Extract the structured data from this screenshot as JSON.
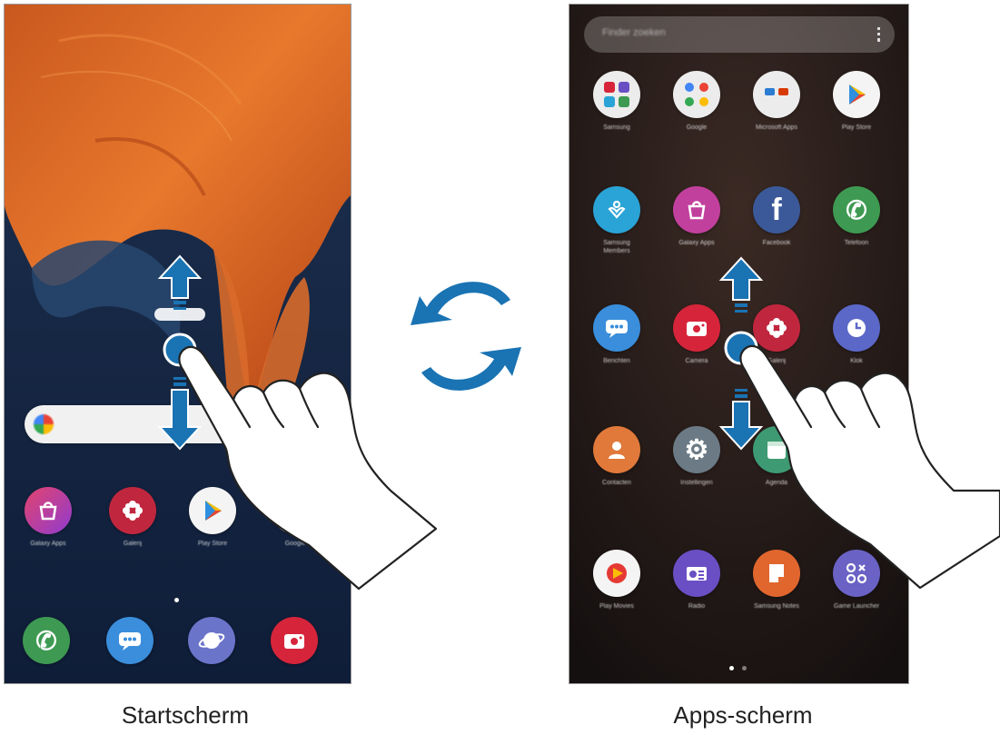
{
  "captions": {
    "home": "Startscherm",
    "apps": "Apps-scherm"
  },
  "home_screen": {
    "search_bar_icon": "google-icon",
    "row_apps": [
      {
        "label": "Galaxy Apps",
        "icon": "galaxy-store-icon",
        "color": "#c2409d"
      },
      {
        "label": "Galerij",
        "icon": "gallery-icon",
        "color": "#c0273e"
      },
      {
        "label": "Play Store",
        "icon": "play-store-icon",
        "color": "#f4f4f4"
      },
      {
        "label": "Google",
        "icon": "google-folder-icon",
        "color": "#e8e8e8"
      }
    ],
    "dock_apps": [
      {
        "icon": "phone-icon",
        "color": "#3e9a52"
      },
      {
        "icon": "messages-icon",
        "color": "#3a8edb"
      },
      {
        "icon": "internet-icon",
        "color": "#6a74c9"
      },
      {
        "icon": "camera-icon",
        "color": "#d6253b"
      }
    ]
  },
  "apps_screen": {
    "finder_placeholder": "Finder zoeken",
    "apps": [
      {
        "label": "Samsung",
        "icon": "samsung-folder-icon",
        "color": "#ececec"
      },
      {
        "label": "Google",
        "icon": "google-folder-icon",
        "color": "#ececec"
      },
      {
        "label": "Microsoft Apps",
        "icon": "microsoft-folder-icon",
        "color": "#ececec"
      },
      {
        "label": "Play Store",
        "icon": "play-store-icon",
        "color": "#f4f4f4"
      },
      {
        "label": "Samsung Members",
        "icon": "samsung-members-icon",
        "color": "#2aa3d6"
      },
      {
        "label": "Galaxy Apps",
        "icon": "galaxy-store-icon",
        "color": "#c2409d"
      },
      {
        "label": "Facebook",
        "icon": "facebook-icon",
        "color": "#3b5998"
      },
      {
        "label": "Telefoon",
        "icon": "phone-icon",
        "color": "#3e9a52"
      },
      {
        "label": "Berichten",
        "icon": "messages-icon",
        "color": "#3a8edb"
      },
      {
        "label": "Camera",
        "icon": "camera-icon",
        "color": "#d6253b"
      },
      {
        "label": "Galerij",
        "icon": "gallery-icon",
        "color": "#c0273e"
      },
      {
        "label": "Klok",
        "icon": "clock-icon",
        "color": "#5b68c8"
      },
      {
        "label": "Contacten",
        "icon": "contacts-icon",
        "color": "#e0793a"
      },
      {
        "label": "Instellingen",
        "icon": "settings-icon",
        "color": "#6b7a85"
      },
      {
        "label": "Agenda",
        "icon": "calendar-icon",
        "color": "#3e9a72"
      },
      {
        "label": "",
        "icon": "blank-icon",
        "color": "#000000"
      },
      {
        "label": "Play Movies",
        "icon": "play-movies-icon",
        "color": "#f4f4f4"
      },
      {
        "label": "Radio",
        "icon": "radio-icon",
        "color": "#6a4fc4"
      },
      {
        "label": "Samsung Notes",
        "icon": "samsung-notes-icon",
        "color": "#e0662e"
      },
      {
        "label": "Game Launcher",
        "icon": "game-launcher-icon",
        "color": "#6a62c4"
      }
    ]
  },
  "gesture": {
    "direction_icon_up": "arrow-up-icon",
    "direction_icon_down": "arrow-down-icon",
    "switch_icon": "sync-arrows-icon",
    "accent_color": "#1a73b3"
  }
}
